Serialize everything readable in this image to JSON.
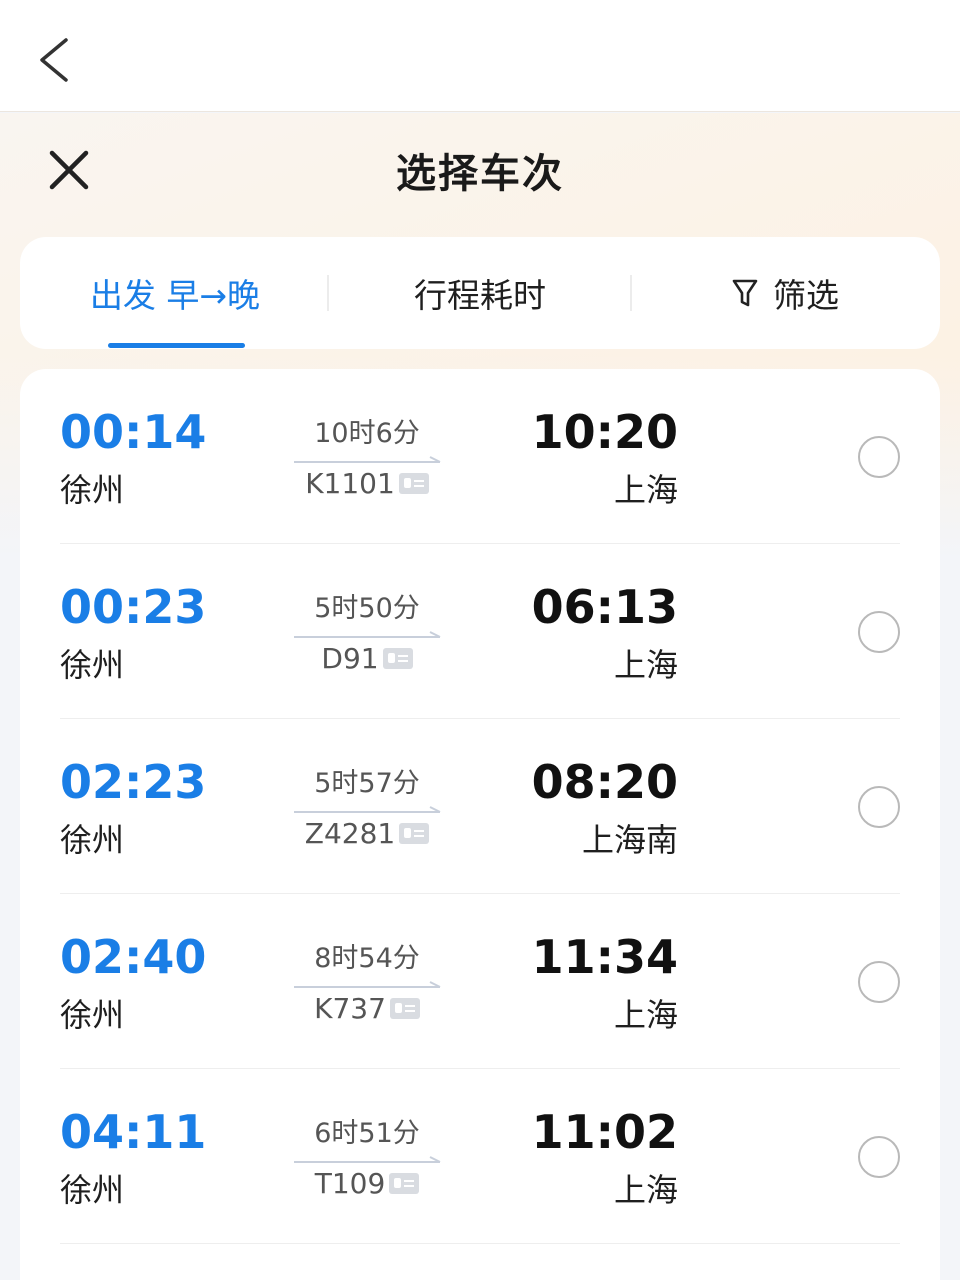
{
  "sheet": {
    "title": "选择车次"
  },
  "sort_bar": {
    "departure_tab": "出发 早→晚",
    "duration_tab": "行程耗时",
    "filter_tab": "筛选"
  },
  "trains": [
    {
      "dep_time": "00:14",
      "dep_station": "徐州",
      "duration": "10时6分",
      "code": "K1101",
      "arr_time": "10:20",
      "arr_station": "上海"
    },
    {
      "dep_time": "00:23",
      "dep_station": "徐州",
      "duration": "5时50分",
      "code": "D91",
      "arr_time": "06:13",
      "arr_station": "上海"
    },
    {
      "dep_time": "02:23",
      "dep_station": "徐州",
      "duration": "5时57分",
      "code": "Z4281",
      "arr_time": "08:20",
      "arr_station": "上海南"
    },
    {
      "dep_time": "02:40",
      "dep_station": "徐州",
      "duration": "8时54分",
      "code": "K737",
      "arr_time": "11:34",
      "arr_station": "上海"
    },
    {
      "dep_time": "04:11",
      "dep_station": "徐州",
      "duration": "6时51分",
      "code": "T109",
      "arr_time": "11:02",
      "arr_station": "上海"
    }
  ],
  "icons": {
    "back": "chevron-left-icon",
    "close": "close-icon",
    "filter": "filter-funnel-icon",
    "ticket": "id-card-icon"
  },
  "colors": {
    "accent": "#1a7ee6",
    "text": "#1f1f1f",
    "muted": "#555555"
  }
}
